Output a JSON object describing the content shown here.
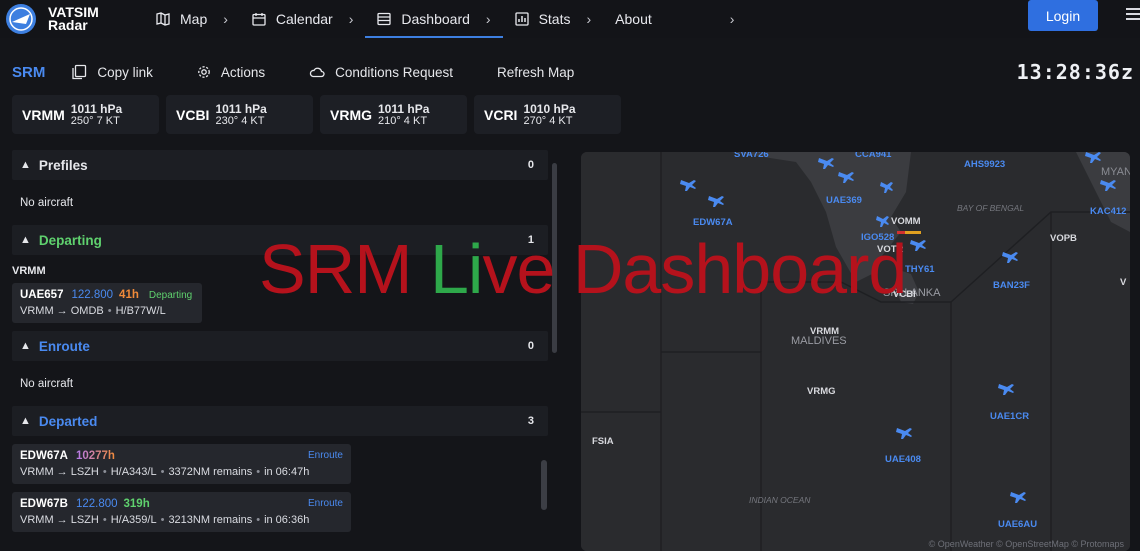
{
  "nav": {
    "brand_line1": "VATSIM",
    "brand_line2": "Radar",
    "items": [
      {
        "label": "Map",
        "chevron": "›"
      },
      {
        "label": "Calendar",
        "chevron": "›"
      },
      {
        "label": "Dashboard",
        "chevron": "›"
      },
      {
        "label": "Stats",
        "chevron": "›"
      },
      {
        "label": "About",
        "chevron": "›"
      }
    ],
    "login_label": "Login"
  },
  "toolbar": {
    "airport": "SRM",
    "copy_link": "Copy link",
    "actions": "Actions",
    "conditions": "Conditions Request",
    "refresh": "Refresh Map",
    "clock": "13:28:36z"
  },
  "weather": [
    {
      "icao": "VRMM",
      "pressure": "1011 hPa",
      "wind": "250° 7 KT"
    },
    {
      "icao": "VCBI",
      "pressure": "1011 hPa",
      "wind": "230° 4 KT"
    },
    {
      "icao": "VRMG",
      "pressure": "1011 hPa",
      "wind": "210° 4 KT"
    },
    {
      "icao": "VCRI",
      "pressure": "1010 hPa",
      "wind": "270° 4 KT"
    }
  ],
  "sections": {
    "prefiles": {
      "title": "Prefiles",
      "count": "0",
      "empty": "No aircraft"
    },
    "departing": {
      "title": "Departing",
      "count": "1",
      "airport": "VRMM",
      "aircraft": {
        "callsign": "UAE657",
        "freq": "122.800",
        "hours": "41h",
        "status": "Departing",
        "route": "VRMM → OMDB",
        "type": "H/B77W/L"
      }
    },
    "enroute": {
      "title": "Enroute",
      "count": "0",
      "empty": "No aircraft"
    },
    "departed": {
      "title": "Departed",
      "count": "3",
      "aircraft": [
        {
          "callsign": "EDW67A",
          "freq": "",
          "hours": "10277h",
          "status": "Enroute",
          "route": "VRMM → LSZH",
          "type": "H/A343/L",
          "remains": "3372NM remains",
          "eta": "in 06:47h"
        },
        {
          "callsign": "EDW67B",
          "freq": "122.800",
          "hours": "319h",
          "status": "Enroute",
          "route": "VRMM → LSZH",
          "type": "H/A359/L",
          "remains": "3213NM remains",
          "eta": "in 06:36h"
        }
      ]
    }
  },
  "map": {
    "labels": {
      "myanmar": "MYANMA",
      "bay_of_bengal": "BAY OF BENGAL",
      "sri_lanka": "SRI LANKA",
      "maldives": "MALDIVES",
      "indian_ocean": "INDIAN OCEAN"
    },
    "airports": {
      "vomm": "VOMM",
      "votr": "VOTR",
      "vcbi": "VCBI",
      "vrmm": "VRMM",
      "vrmg": "VRMG",
      "fsia": "FSIA",
      "vopb": "VOPB",
      "v_edge": "V"
    },
    "flights": {
      "sva": "SVA726",
      "cca": "CCA941",
      "ahs": "AHS9923",
      "kac": "KAC412",
      "edw": "EDW67A",
      "uae369": "UAE369",
      "igo": "IGO528",
      "thy": "THY61",
      "ban": "BAN23F",
      "uae1cr": "UAE1CR",
      "uae408": "UAE408",
      "uae6au": "UAE6AU"
    },
    "attribution": "© OpenWeather  © OpenStreetMap  © Protomaps"
  },
  "overlay": {
    "part1": "SRM ",
    "part2": "Li",
    "part3": "ve Dashboard"
  },
  "colors": {
    "accent": "#3d7fe0",
    "departing": "#5fd16e",
    "enroute": "#4a8af0",
    "overlay_red": "#b5121c",
    "overlay_green": "#2ea84a"
  }
}
